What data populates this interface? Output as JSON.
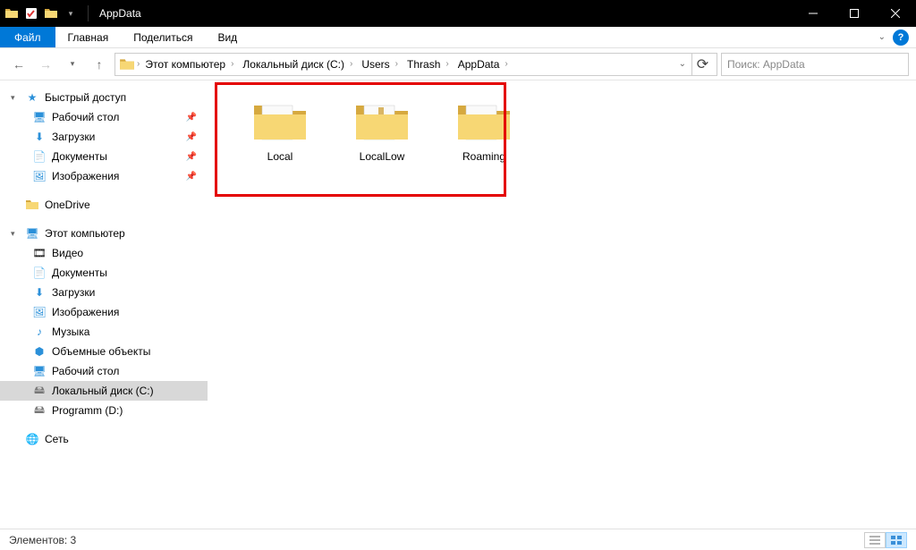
{
  "window": {
    "title": "AppData"
  },
  "ribbon": {
    "file": "Файл",
    "tabs": [
      "Главная",
      "Поделиться",
      "Вид"
    ]
  },
  "breadcrumbs": [
    "Этот компьютер",
    "Локальный диск (C:)",
    "Users",
    "Thrash",
    "AppData"
  ],
  "search": {
    "placeholder": "Поиск: AppData"
  },
  "sidebar": {
    "quick": {
      "label": "Быстрый доступ",
      "items": [
        {
          "label": "Рабочий стол",
          "pinned": true
        },
        {
          "label": "Загрузки",
          "pinned": true
        },
        {
          "label": "Документы",
          "pinned": true
        },
        {
          "label": "Изображения",
          "pinned": true
        }
      ]
    },
    "onedrive": {
      "label": "OneDrive"
    },
    "pc": {
      "label": "Этот компьютер",
      "items": [
        {
          "label": "Видео"
        },
        {
          "label": "Документы"
        },
        {
          "label": "Загрузки"
        },
        {
          "label": "Изображения"
        },
        {
          "label": "Музыка"
        },
        {
          "label": "Объемные объекты"
        },
        {
          "label": "Рабочий стол"
        },
        {
          "label": "Локальный диск (C:)",
          "selected": true
        },
        {
          "label": "Programm (D:)"
        }
      ]
    },
    "network": {
      "label": "Сеть"
    }
  },
  "folders": [
    {
      "name": "Local"
    },
    {
      "name": "LocalLow"
    },
    {
      "name": "Roaming"
    }
  ],
  "status": {
    "count_label": "Элементов: 3"
  }
}
